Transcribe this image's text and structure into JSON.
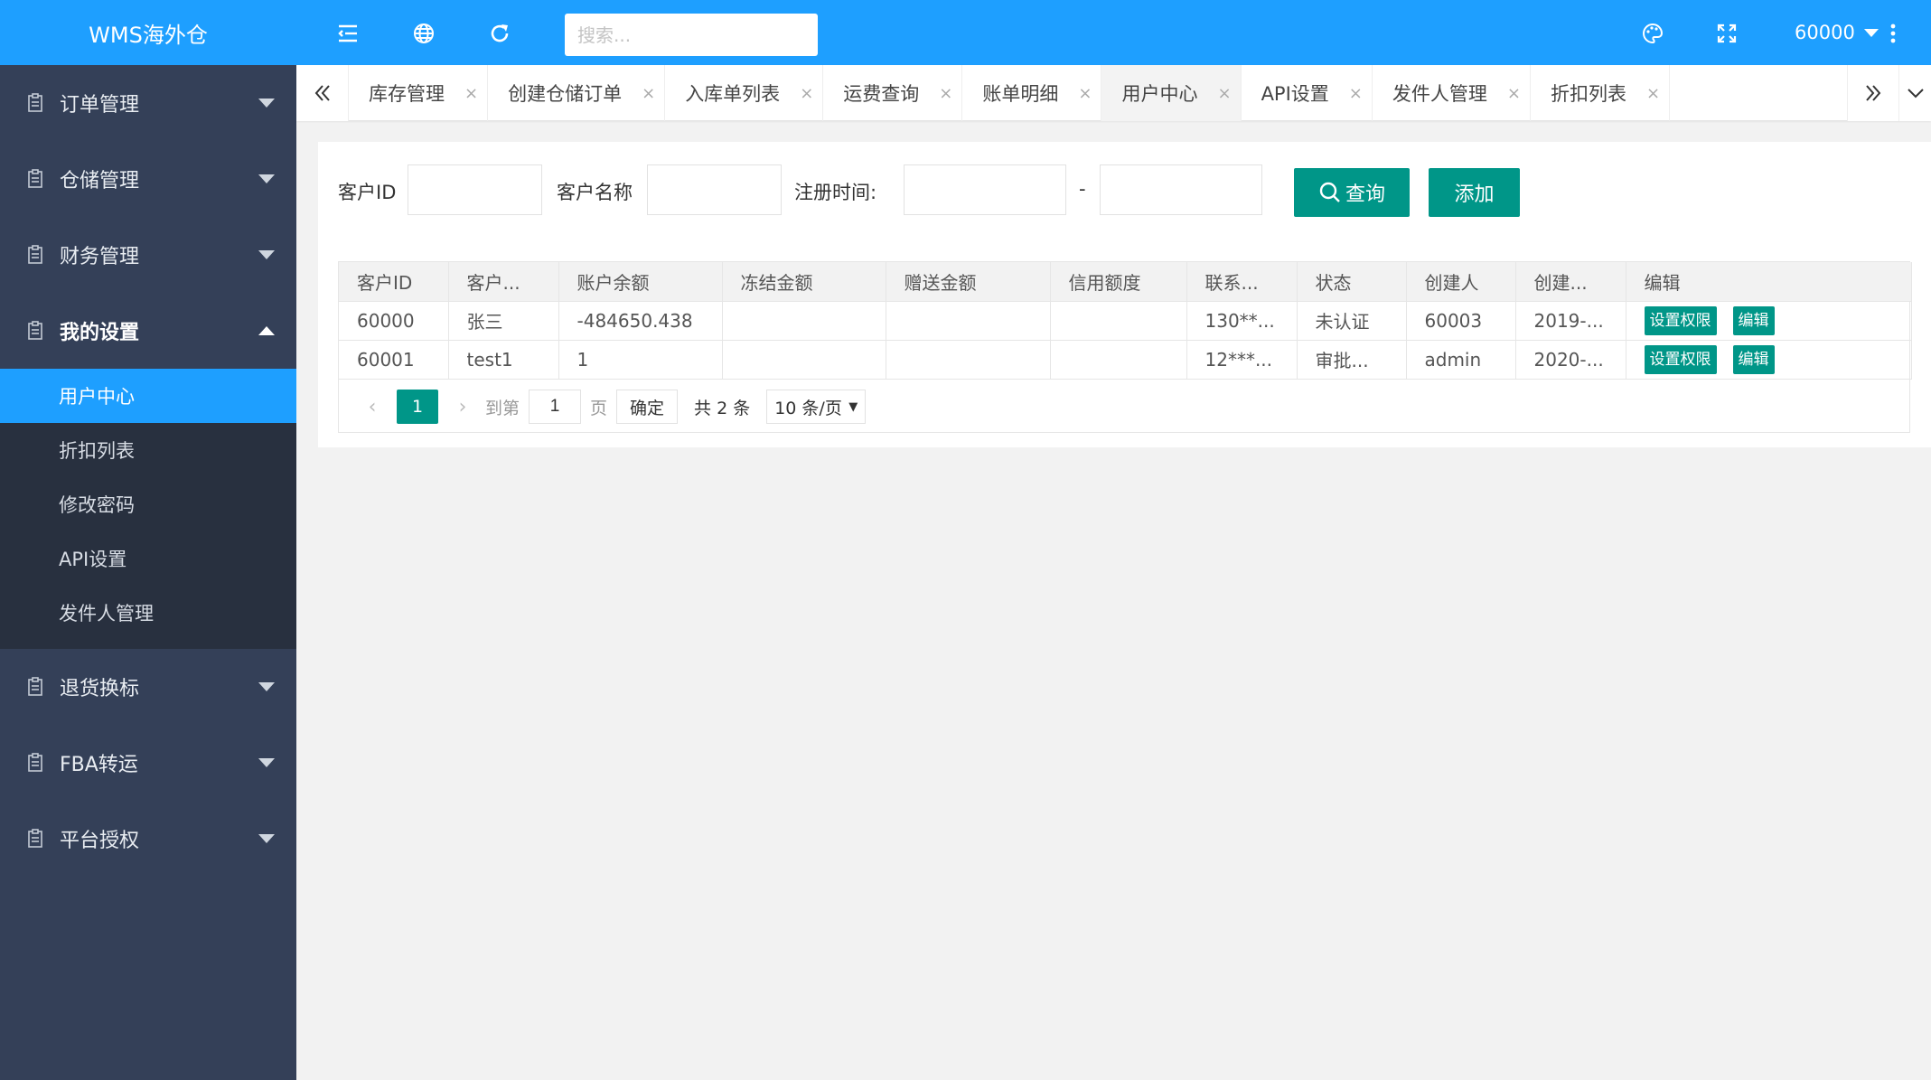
{
  "app": {
    "title": "WMS海外仓"
  },
  "sidebar": {
    "items_top": [
      {
        "label": "订单管理"
      },
      {
        "label": "仓储管理"
      },
      {
        "label": "财务管理"
      },
      {
        "label": "我的设置"
      }
    ],
    "submenu": [
      {
        "label": "用户中心",
        "active": true
      },
      {
        "label": "折扣列表"
      },
      {
        "label": "修改密码"
      },
      {
        "label": "API设置"
      },
      {
        "label": "发件人管理"
      }
    ],
    "items_bottom": [
      {
        "label": "退货换标"
      },
      {
        "label": "FBA转运"
      },
      {
        "label": "平台授权"
      }
    ]
  },
  "topbar": {
    "search_placeholder": "搜索...",
    "user": "60000",
    "icons": [
      "menu-fold-icon",
      "globe-icon",
      "refresh-icon",
      "palette-icon",
      "fullscreen-icon",
      "more-vertical-icon"
    ]
  },
  "tabs": [
    {
      "label": "库存管理"
    },
    {
      "label": "创建仓储订单"
    },
    {
      "label": "入库单列表"
    },
    {
      "label": "运费查询"
    },
    {
      "label": "账单明细"
    },
    {
      "label": "用户中心",
      "active": true
    },
    {
      "label": "API设置"
    },
    {
      "label": "发件人管理"
    },
    {
      "label": "折扣列表"
    }
  ],
  "tab_close_glyph": "×",
  "filter": {
    "customer_id_label": "客户ID",
    "customer_name_label": "客户名称",
    "reg_time_label": "注册时间:",
    "range_sep": "-",
    "query_button": "查询",
    "add_button": "添加"
  },
  "table": {
    "headers": [
      "客户ID",
      "客户...",
      "账户余额",
      "冻结金额",
      "赠送金额",
      "信用额度",
      "联系...",
      "状态",
      "创建人",
      "创建...",
      "编辑"
    ],
    "rows": [
      [
        "60000",
        "张三",
        "-484650.438",
        "",
        "",
        "",
        "130**...",
        "未认证",
        "60003",
        "2019-..."
      ],
      [
        "60001",
        "test1",
        "1",
        "",
        "",
        "",
        "12***...",
        "审批...",
        "admin",
        "2020-..."
      ]
    ],
    "row_actions": {
      "permissions": "设置权限",
      "edit": "编辑"
    }
  },
  "pager": {
    "current_page": "1",
    "goto_label": "到第",
    "goto_value": "1",
    "page_unit": "页",
    "confirm": "确定",
    "total": "共 2 条",
    "page_size": "10 条/页"
  },
  "colors": {
    "topbar": "#1E9FFF",
    "sidebar": "#344058",
    "primary_button": "#009688"
  }
}
